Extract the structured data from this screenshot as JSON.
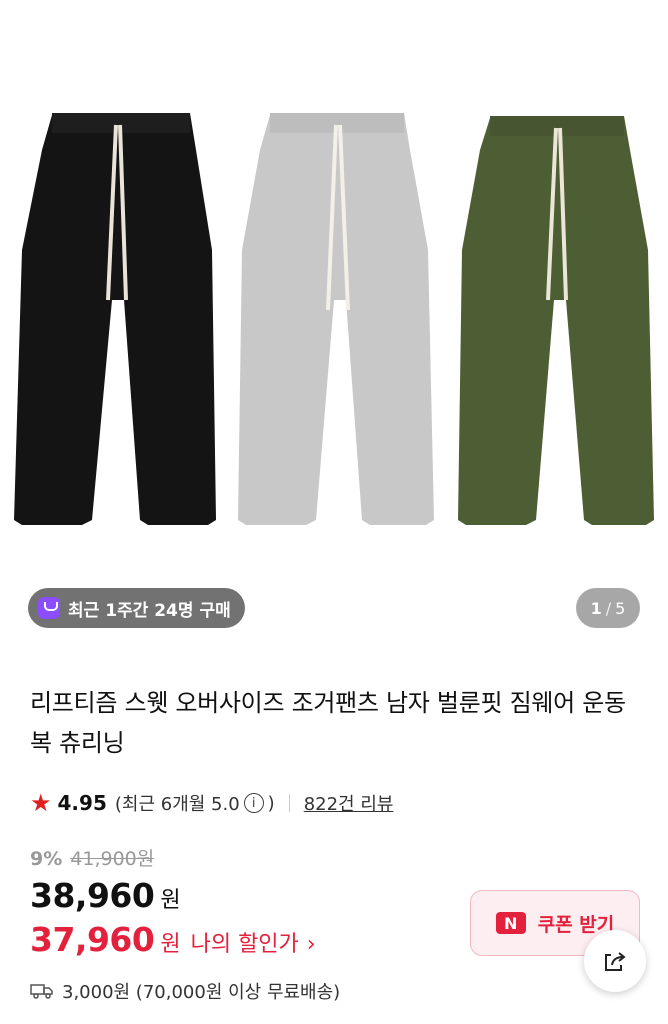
{
  "gallery": {
    "recent_badge": "최근 1주간 24명 구매",
    "pager_current": "1",
    "pager_separator": "/",
    "pager_total": "5",
    "colors": [
      "#141414",
      "#c8c8c8",
      "#4e5e34"
    ]
  },
  "product": {
    "title": "리프티즘 스웻 오버사이즈 조거팬츠 남자 벌룬핏 짐웨어 운동복 츄리닝",
    "rating_score": "4.95",
    "rating_recent": "(최근 6개월 5.0",
    "rating_recent_close": ")",
    "reviews_count": "822건 리뷰"
  },
  "pricing": {
    "discount_rate": "9%",
    "original_price": "41,900원",
    "price": "38,960",
    "price_unit": "원",
    "my_price": "37,960",
    "my_price_unit": "원",
    "my_price_label": "나의 할인가",
    "shipping": "3,000원 (70,000원 이상 무료배송)"
  },
  "actions": {
    "coupon_icon": "N",
    "coupon_label": "쿠폰 받기"
  },
  "theme": {
    "accent_red": "#e3213c",
    "badge_purple": "#8a4dff"
  }
}
